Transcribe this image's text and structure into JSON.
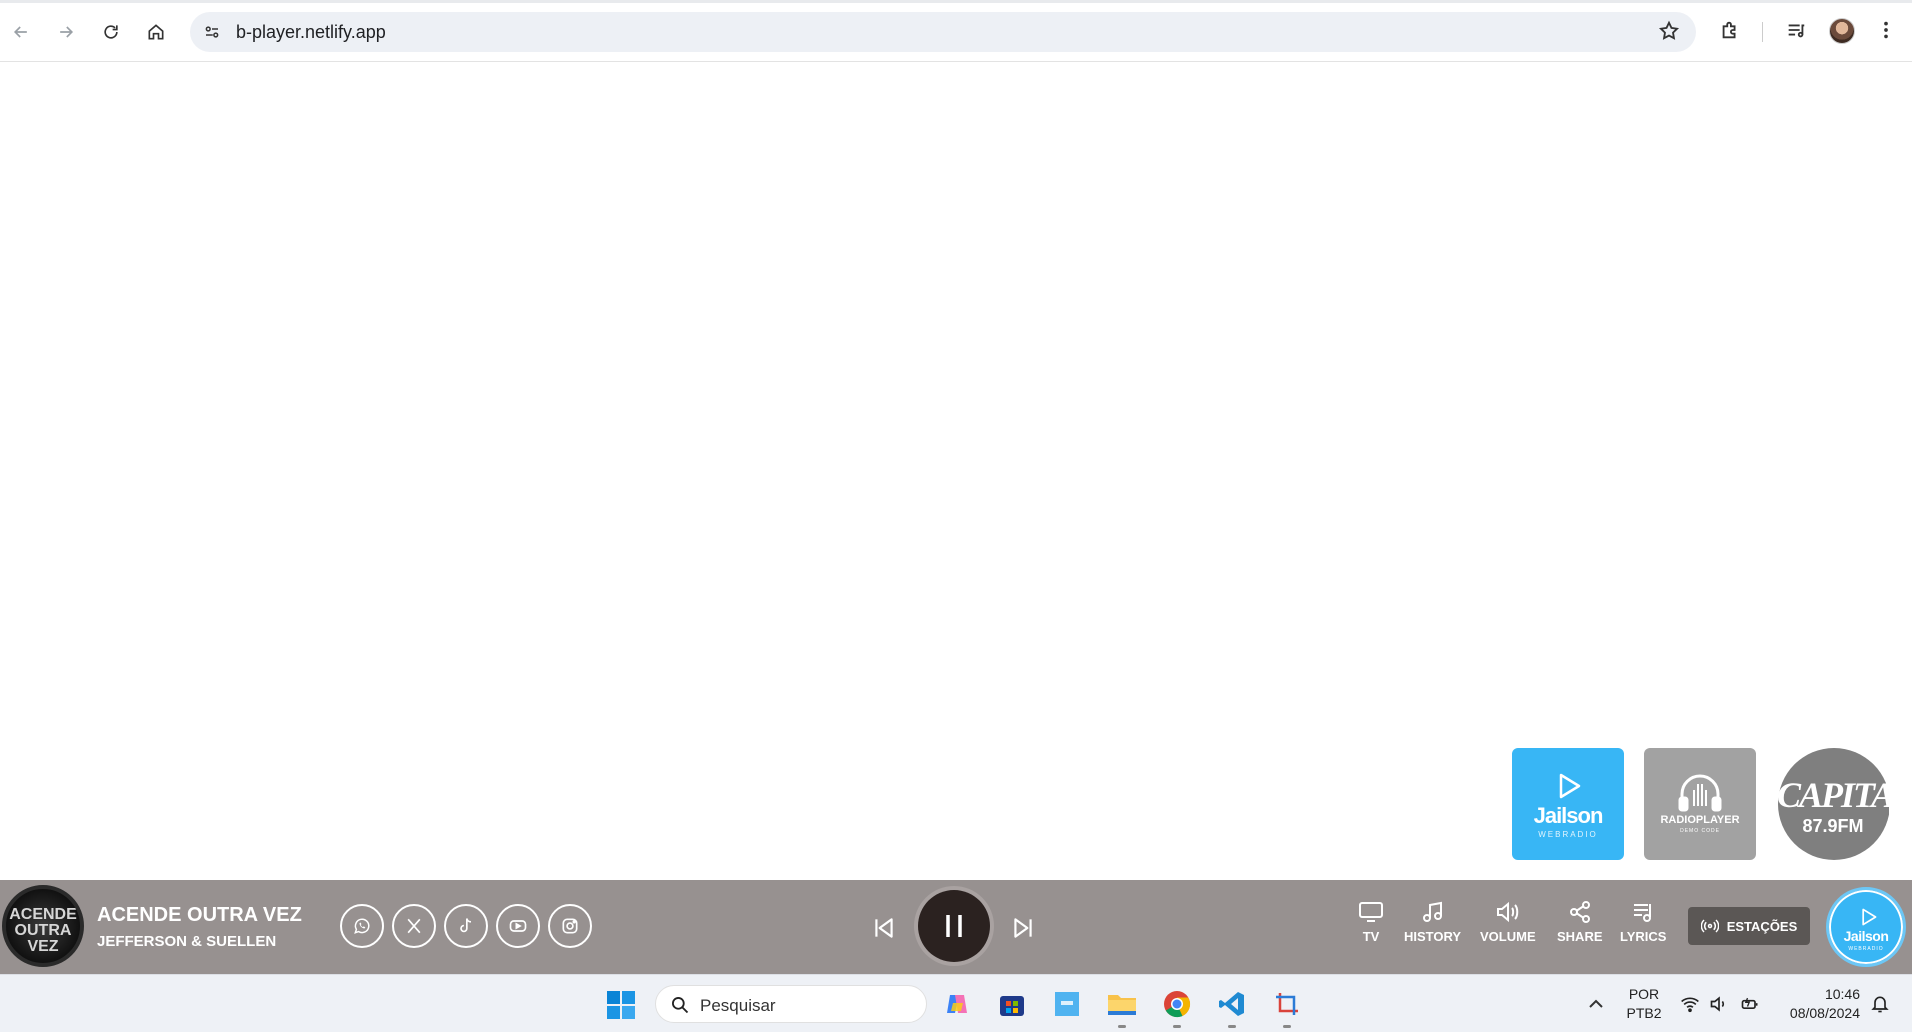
{
  "browser": {
    "url": "b-player.netlify.app"
  },
  "stations_tiles": [
    {
      "name": "Jailson",
      "sub": "WEBRADIO",
      "color": "#38b6f5"
    },
    {
      "name": "RADIOPLAYER",
      "sub": "DEMO CODE",
      "color": "#a2a2a2"
    },
    {
      "name": "CAPITAL",
      "sub": "87.9FM",
      "color": "#7f7f7f"
    }
  ],
  "player": {
    "song_title": "ACENDE OUTRA VEZ",
    "artist": "JEFFERSON & SUELLEN",
    "cover_text": "ACENDE OUTRA VEZ",
    "social": [
      "whatsapp-icon",
      "x-icon",
      "tiktok-icon",
      "youtube-icon",
      "instagram-icon"
    ],
    "actions": {
      "tv": "TV",
      "history": "HISTORY",
      "volume": "VOLUME",
      "share": "SHARE",
      "lyrics": "LYRICS"
    },
    "stations_button": "ESTAÇÕES",
    "current_station": {
      "name": "Jailson",
      "sub": "WEBRADIO"
    },
    "bar_color": "#979190"
  },
  "taskbar": {
    "search_placeholder": "Pesquisar",
    "lang_line1": "POR",
    "lang_line2": "PTB2",
    "time": "10:46",
    "date": "08/08/2024"
  }
}
